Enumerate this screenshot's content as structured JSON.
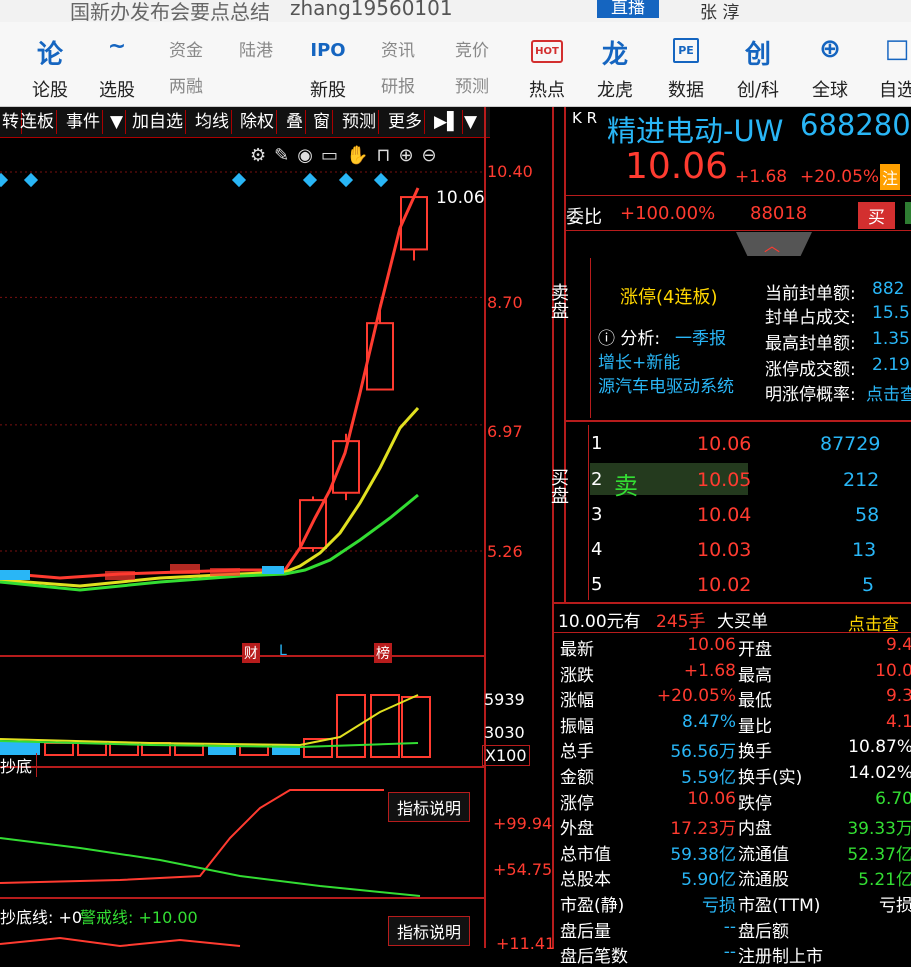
{
  "titlebar": {
    "news_text": "国新办发布会要点总结",
    "username": "zhang19560101",
    "live_label": "直播",
    "user_label": "张  淳"
  },
  "toolbar": {
    "items": [
      {
        "icon": "论",
        "label": "论股"
      },
      {
        "icon": "~",
        "label": "选股"
      },
      {
        "top": "资金",
        "label": "两融"
      },
      {
        "top": "陆港",
        "label": ""
      },
      {
        "icon": "IPO",
        "label": "新股"
      },
      {
        "top": "资讯",
        "label": "研报"
      },
      {
        "top": "竞价",
        "label": "预测"
      },
      {
        "icon": "HOT",
        "label": "热点"
      },
      {
        "icon": "龙",
        "label": "龙虎"
      },
      {
        "icon": "PE",
        "label": "数据"
      },
      {
        "icon": "创",
        "label": "创/科"
      },
      {
        "icon": "⊕",
        "label": "全球"
      },
      {
        "icon": "□",
        "label": "自选"
      }
    ]
  },
  "navbar": {
    "items": [
      "转",
      "连板",
      "事件",
      "▼",
      "加自选",
      "均线",
      "除权",
      "叠",
      "窗",
      "预测",
      "更多",
      "▶▌",
      "▼"
    ]
  },
  "chart": {
    "price_ticks": [
      "10.40",
      "8.70",
      "6.97",
      "5.26"
    ],
    "last_price_label": "10.06",
    "event_markers": [
      "财",
      "L",
      "榜"
    ],
    "volume_ticks": [
      "5939",
      "3030",
      "X100"
    ],
    "indicator1_name": "抄底",
    "indicator1_ticks": [
      "+99.94",
      "+54.75"
    ],
    "indicator_btn": "指标说明",
    "indicator2_labels": {
      "a": "抄底线: +0",
      "b": "警戒线: +10.00"
    },
    "indicator2_tick": "+11.41",
    "candles": [
      {
        "o": 5.3,
        "c": 5.95,
        "h": 6.0,
        "l": 5.25
      },
      {
        "o": 6.05,
        "c": 6.75,
        "h": 6.85,
        "l": 5.95
      },
      {
        "o": 7.45,
        "c": 8.35,
        "h": 8.6,
        "l": 7.45
      },
      {
        "o": 9.35,
        "c": 10.06,
        "h": 10.06,
        "l": 9.2
      }
    ]
  },
  "quote": {
    "kr": "K R",
    "name": "精进电动-UW",
    "code": "688280",
    "price": "10.06",
    "change": "+1.68",
    "change_pct": "+20.05%",
    "note_badge": "注",
    "webi_label": "委比",
    "webi_value": "+100.00%",
    "webi_diff": "88018",
    "buy_badge": "买",
    "sell_side_label": "卖盘",
    "limit_up": "涨停(4连板)",
    "analysis_prefix": "ⓘ 分析:",
    "analysis_link": "一季报",
    "tag1": "增长+新能",
    "tag2": "源汽车电驱动系统",
    "seal_stats": [
      {
        "label": "当前封单额:",
        "value": "882"
      },
      {
        "label": "封单占成交:",
        "value": "15.5"
      },
      {
        "label": "最高封单额:",
        "value": "1.35"
      },
      {
        "label": "涨停成交额:",
        "value": "2.19"
      },
      {
        "label": "明涨停概率:",
        "value": "点击查"
      }
    ],
    "buy_side_label": "买盘",
    "sell_hint": "卖",
    "bids": [
      {
        "level": "1",
        "price": "10.06",
        "vol": "87729"
      },
      {
        "level": "2",
        "price": "10.05",
        "vol": "212"
      },
      {
        "level": "3",
        "price": "10.04",
        "vol": "58"
      },
      {
        "level": "4",
        "price": "10.03",
        "vol": "13"
      },
      {
        "level": "5",
        "price": "10.02",
        "vol": "5"
      }
    ],
    "bigorder": {
      "a": "10.00元有",
      "b": "245手",
      "c": "大买单",
      "d": "点击查"
    },
    "stats": [
      {
        "l1": "最新",
        "v1": "10.06",
        "l2": "开盘",
        "v2": "9.4"
      },
      {
        "l1": "涨跌",
        "v1": "+1.68",
        "l2": "最高",
        "v2": "10.0"
      },
      {
        "l1": "涨幅",
        "v1": "+20.05%",
        "l2": "最低",
        "v2": "9.3"
      },
      {
        "l1": "振幅",
        "v1": "8.47%",
        "l2": "量比",
        "v2": "4.1"
      },
      {
        "l1": "总手",
        "v1": "56.56万",
        "l2": "换手",
        "v2": "10.87%"
      },
      {
        "l1": "金额",
        "v1": "5.59亿",
        "l2": "换手(实)",
        "v2": "14.02%"
      },
      {
        "l1": "涨停",
        "v1": "10.06",
        "l2": "跌停",
        "v2": "6.70"
      },
      {
        "l1": "外盘",
        "v1": "17.23万",
        "l2": "内盘",
        "v2": "39.33万"
      },
      {
        "l1": "总市值",
        "v1": "59.38亿",
        "l2": "流通值",
        "v2": "52.37亿"
      },
      {
        "l1": "总股本",
        "v1": "5.90亿",
        "l2": "流通股",
        "v2": "5.21亿"
      },
      {
        "l1": "市盈(静)",
        "v1": "亏损",
        "l2": "市盈(TTM)",
        "v2": "亏损"
      },
      {
        "l1": "盘后量",
        "v1": "--",
        "l2": "盘后额",
        "v2": ""
      },
      {
        "l1": "盘后笔数",
        "v1": "--",
        "l2": "注册制上市",
        "v2": ""
      }
    ]
  },
  "colors": {
    "up": "#ff3b30",
    "down": "#33dd33",
    "accent": "#29b6f6",
    "grid": "#b71c1c"
  }
}
